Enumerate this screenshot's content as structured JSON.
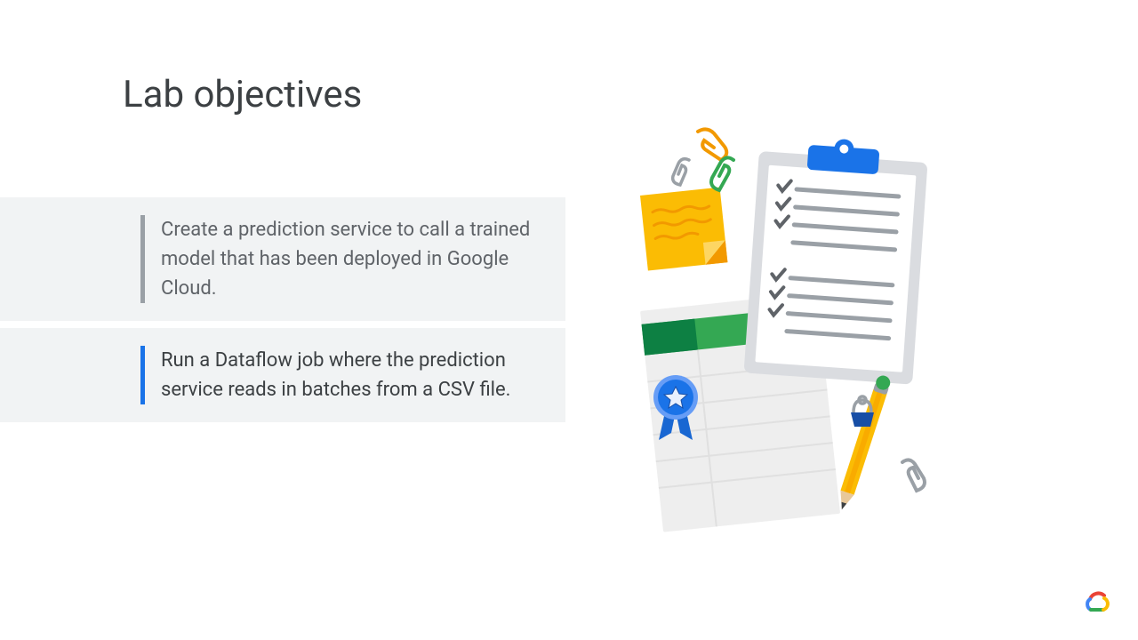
{
  "title": "Lab objectives",
  "objectives": [
    {
      "text": "Create a prediction service to call a trained model that has been deployed in Google Cloud.",
      "active": false
    },
    {
      "text": "Run a Dataflow job where the prediction service reads in batches from a CSV file.",
      "active": true
    }
  ]
}
